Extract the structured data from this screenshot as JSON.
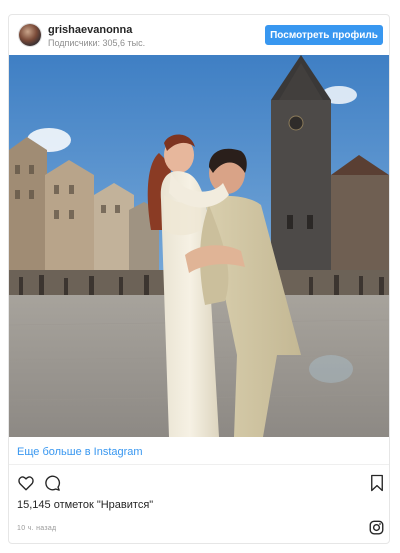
{
  "post": {
    "username": "grishaevanonna",
    "followers": "Подписчики: 305,6 тыс.",
    "profile_button": "Посмотреть профиль",
    "more_link": "Еще больше в Instagram",
    "likes": "15,145 отметок \"Нравится\"",
    "time_ago": "10 ч. назад"
  },
  "colors": {
    "accent": "#3897f0",
    "border": "#e6e6e6",
    "muted": "#8e8e8e"
  },
  "icons": [
    "heart-icon",
    "comment-icon",
    "bookmark-icon",
    "instagram-logo-icon"
  ]
}
